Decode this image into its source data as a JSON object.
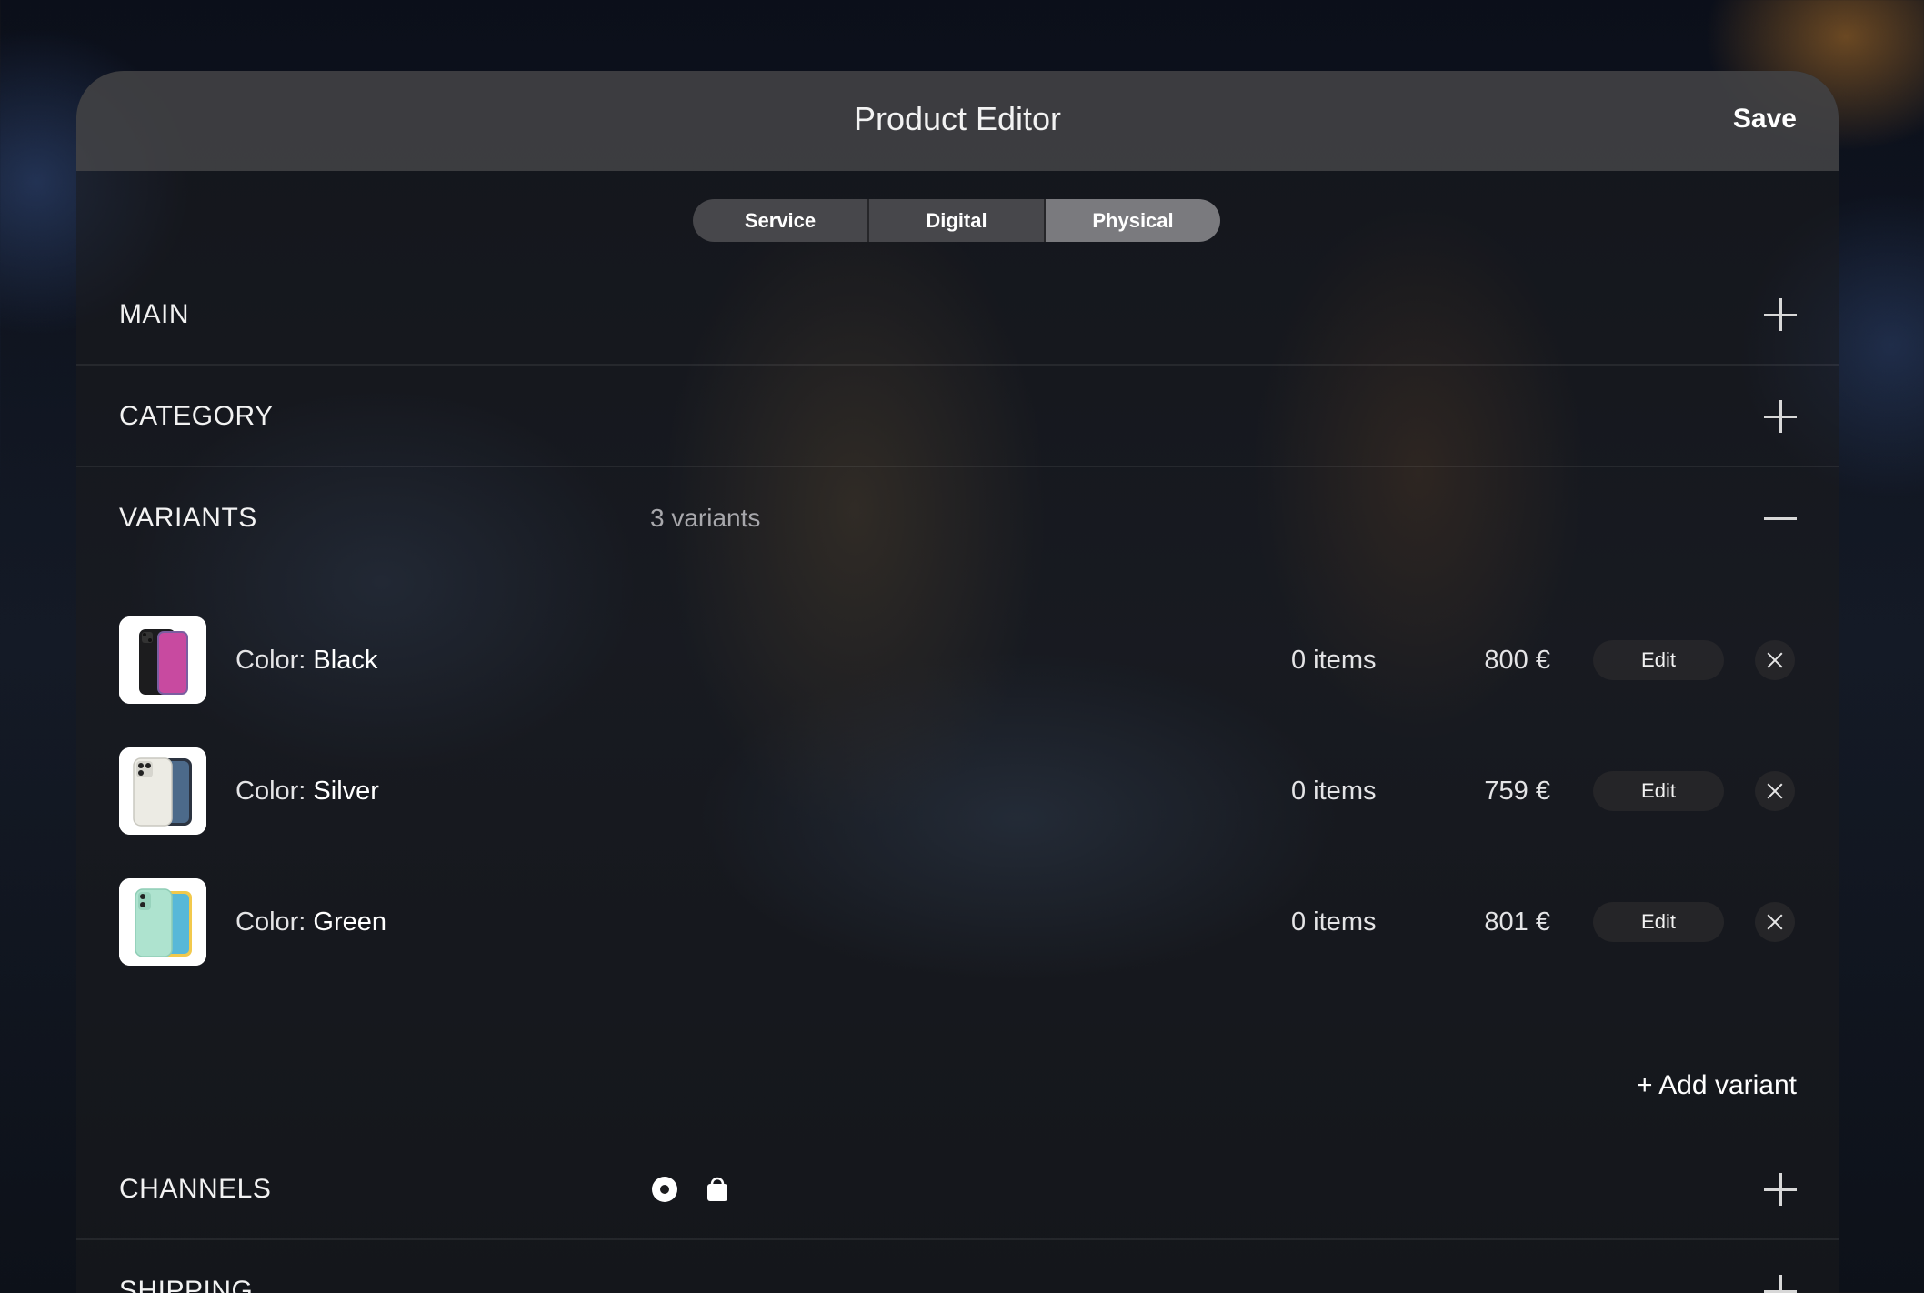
{
  "header": {
    "title": "Product Editor",
    "save_label": "Save"
  },
  "type_tabs": [
    {
      "label": "Service",
      "active": false
    },
    {
      "label": "Digital",
      "active": false
    },
    {
      "label": "Physical",
      "active": true
    }
  ],
  "sections": {
    "main": {
      "label": "MAIN",
      "expanded": false
    },
    "category": {
      "label": "CATEGORY",
      "expanded": false
    },
    "variants": {
      "label": "VARIANTS",
      "summary": "3 variants",
      "expanded": true
    },
    "channels": {
      "label": "CHANNELS",
      "expanded": false,
      "icons": [
        "record-icon",
        "shopping-bag-icon"
      ]
    },
    "shipping": {
      "label": "SHIPPING",
      "expanded": false
    }
  },
  "variants": [
    {
      "attr": "Color:",
      "value": "Black",
      "quantity": "0 items",
      "price": "800 €",
      "edit_label": "Edit",
      "swatch": "#1c1c1e",
      "image": "black-phone"
    },
    {
      "attr": "Color:",
      "value": "Silver",
      "quantity": "0 items",
      "price": "759 €",
      "edit_label": "Edit",
      "swatch": "#f0efe8",
      "image": "silver-phone"
    },
    {
      "attr": "Color:",
      "value": "Green",
      "quantity": "0 items",
      "price": "801 €",
      "edit_label": "Edit",
      "swatch": "#aee3cf",
      "image": "green-phone"
    }
  ],
  "add_variant_label": "+ Add variant",
  "colors": {
    "panel_header": "#48484a",
    "text": "#ffffff",
    "muted": "#a8a8ac"
  }
}
